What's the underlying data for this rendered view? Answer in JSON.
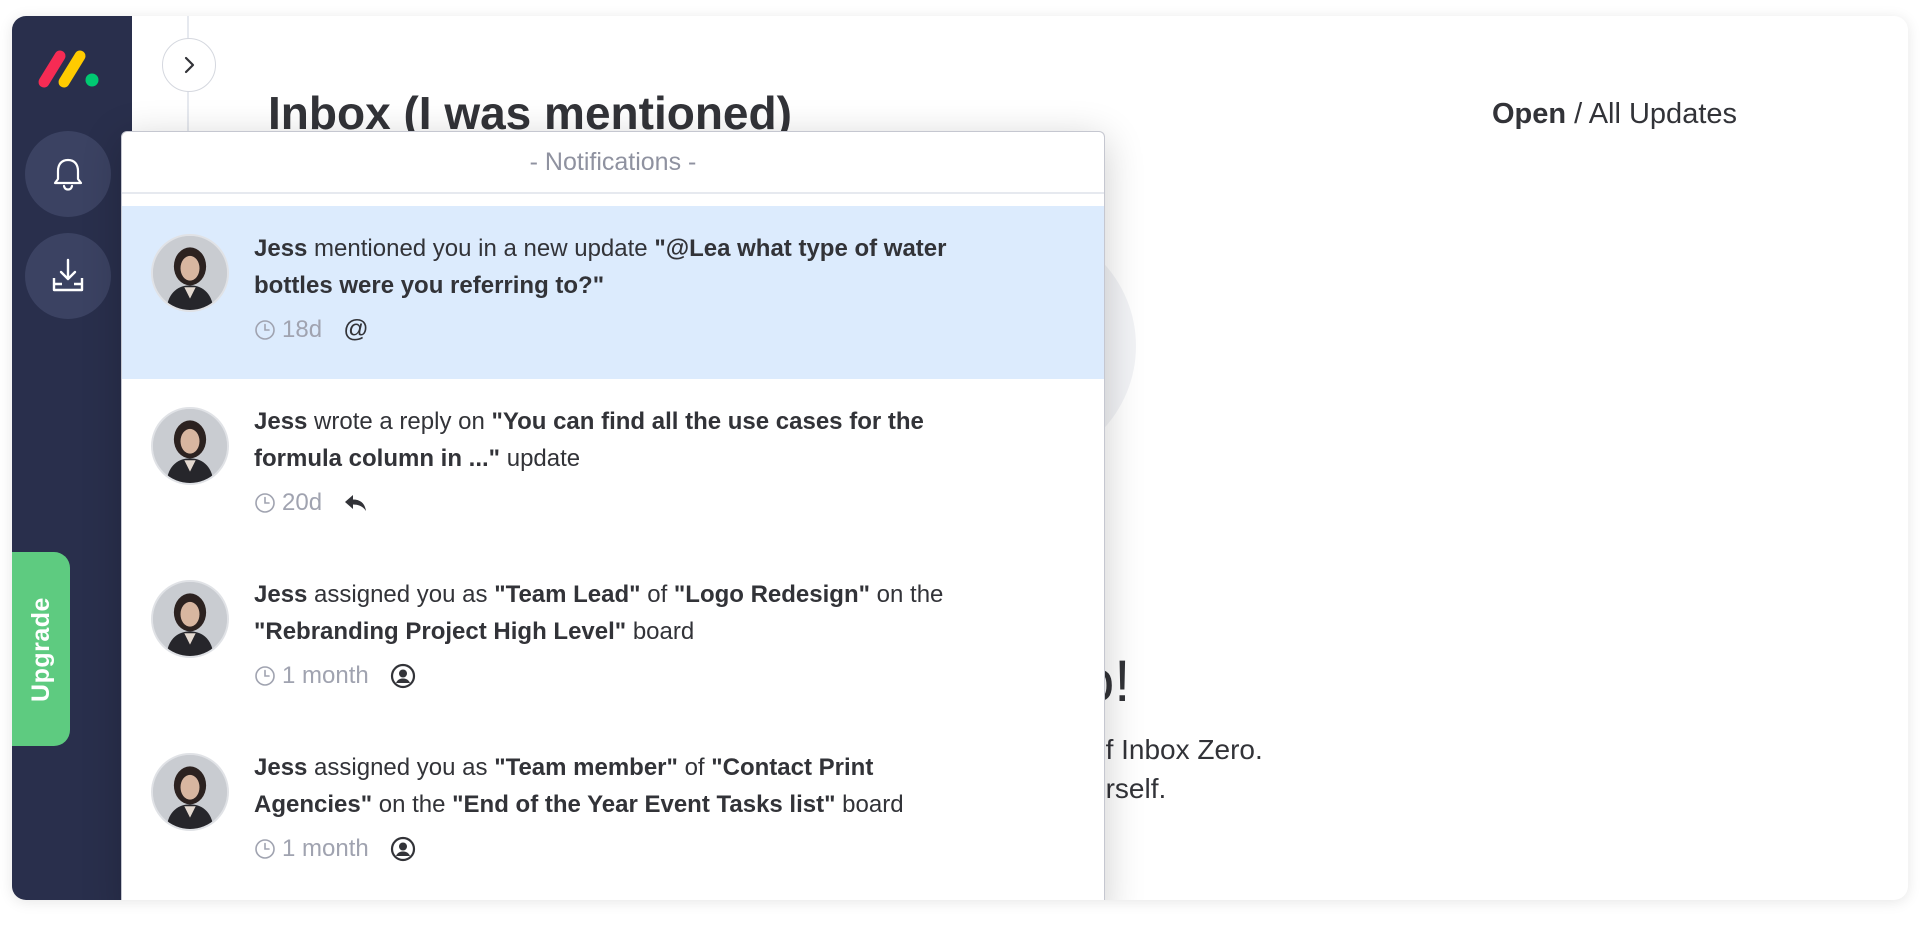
{
  "sidebar": {
    "logo_colors": [
      "#f62b54",
      "#ffcb00",
      "#00ca72"
    ],
    "upgrade_label": "Upgrade",
    "icons": [
      "bell-icon",
      "inbox-download-icon"
    ]
  },
  "header": {
    "title": "Inbox (I was mentioned)",
    "filter_open": "Open",
    "filter_separator": " / ",
    "filter_all": "All Updates"
  },
  "background": {
    "zero_title_fragment": "o!",
    "zero_line1_fragment": "of Inbox Zero.",
    "zero_line2_fragment": "urself."
  },
  "notifications": {
    "header": "- Notifications -",
    "items": [
      {
        "user": "Jess",
        "parts": [
          " mentioned you in a new update ",
          "\"@Lea  what type of water bottles were you referring to?\""
        ],
        "time": "18d",
        "type_icon": "at-icon",
        "active": true
      },
      {
        "user": "Jess",
        "parts": [
          " wrote a reply on ",
          "\"You can find all the use cases for the formula column in ...\"",
          " update"
        ],
        "time": "20d",
        "type_icon": "reply-icon",
        "active": false
      },
      {
        "user": "Jess",
        "parts": [
          " assigned you as ",
          "\"Team Lead\"",
          " of ",
          "\"Logo Redesign\"",
          " on the ",
          "\"Rebranding Project High Level\"",
          " board"
        ],
        "time": "1 month",
        "type_icon": "person-icon",
        "active": false
      },
      {
        "user": "Jess",
        "parts": [
          " assigned you as ",
          "\"Team member\"",
          " of ",
          "\"Contact Print Agencies\"",
          " on the ",
          "\"End of the Year Event Tasks list\"",
          " board"
        ],
        "time": "1 month",
        "type_icon": "person-icon",
        "active": false
      }
    ]
  }
}
